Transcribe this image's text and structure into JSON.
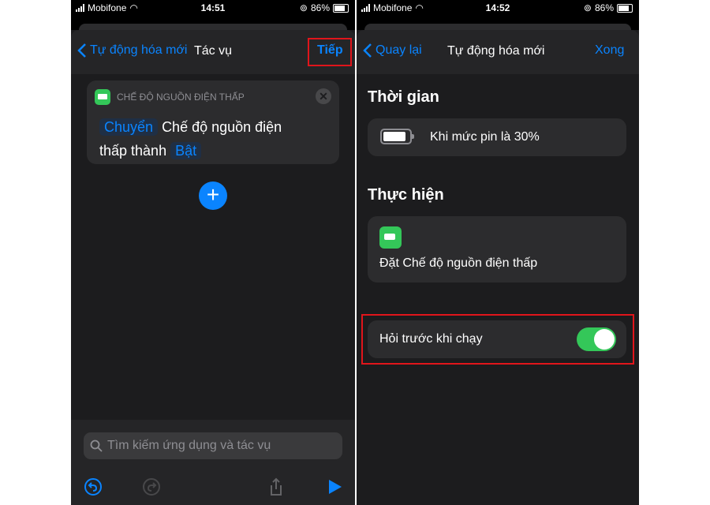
{
  "left": {
    "status": {
      "carrier": "Mobifone",
      "time": "14:51",
      "battery": "86%"
    },
    "nav": {
      "back_label": "Tự động hóa mới",
      "title": "Tác vụ",
      "next_label": "Tiếp"
    },
    "action_card": {
      "header": "CHẾ ĐỘ NGUỒN ĐIỆN THẤP",
      "token_toggle": "Chuyển",
      "text_1": "Chế độ nguồn điện",
      "text_2": "thấp thành",
      "token_state": "Bật"
    },
    "search": {
      "placeholder": "Tìm kiếm ứng dụng và tác vụ"
    }
  },
  "right": {
    "status": {
      "carrier": "Mobifone",
      "time": "14:52",
      "battery": "86%"
    },
    "nav": {
      "back_label": "Quay lại",
      "title": "Tự động hóa mới",
      "done_label": "Xong"
    },
    "trigger_section": {
      "title": "Thời gian",
      "item": "Khi mức pin là 30%"
    },
    "action_section": {
      "title": "Thực hiện",
      "item": "Đặt Chế độ nguồn điện thấp"
    },
    "ask_before_running": {
      "label": "Hỏi trước khi chạy",
      "enabled": true
    }
  },
  "colors": {
    "accent": "#0a84ff",
    "toggle_on": "#34c759",
    "highlight": "#e0151b"
  }
}
